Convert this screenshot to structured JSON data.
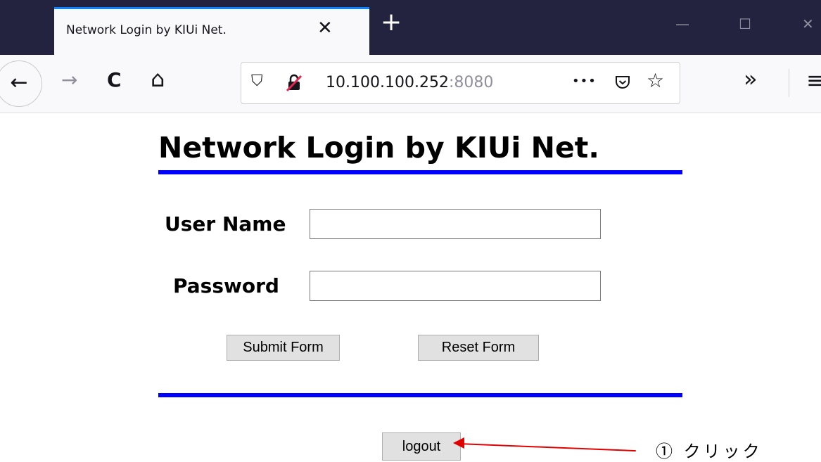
{
  "browser": {
    "tab": {
      "title": "Network Login by KIUi Net.",
      "close_glyph": "✕"
    },
    "new_tab_glyph": "+",
    "window_controls": {
      "minimize": "—",
      "maximize": "☐",
      "close": "✕"
    },
    "nav": {
      "back_glyph": "←",
      "forward_glyph": "→",
      "reload_glyph": "C",
      "home_glyph": "⌂",
      "overflow_glyph": "»",
      "menu_glyph": "≡"
    },
    "url": {
      "host": "10.100.100.252",
      "port": ":8080",
      "shield_glyph": "⛉",
      "insecure_glyph": "🔓",
      "page_actions_glyph": "•••",
      "pocket_glyph": "⛉",
      "star_glyph": "☆"
    }
  },
  "page": {
    "title": "Network Login by KIUi Net.",
    "username_label": "User Name",
    "password_label": "Password",
    "submit_label": "Submit Form",
    "reset_label": "Reset Form",
    "logout_label": "logout"
  },
  "annotation": {
    "text": "① クリック",
    "color": "#e00000"
  },
  "colors": {
    "rule": "#0000ff",
    "titlebar": "#23233f",
    "tab_accent": "#0a84ff"
  }
}
